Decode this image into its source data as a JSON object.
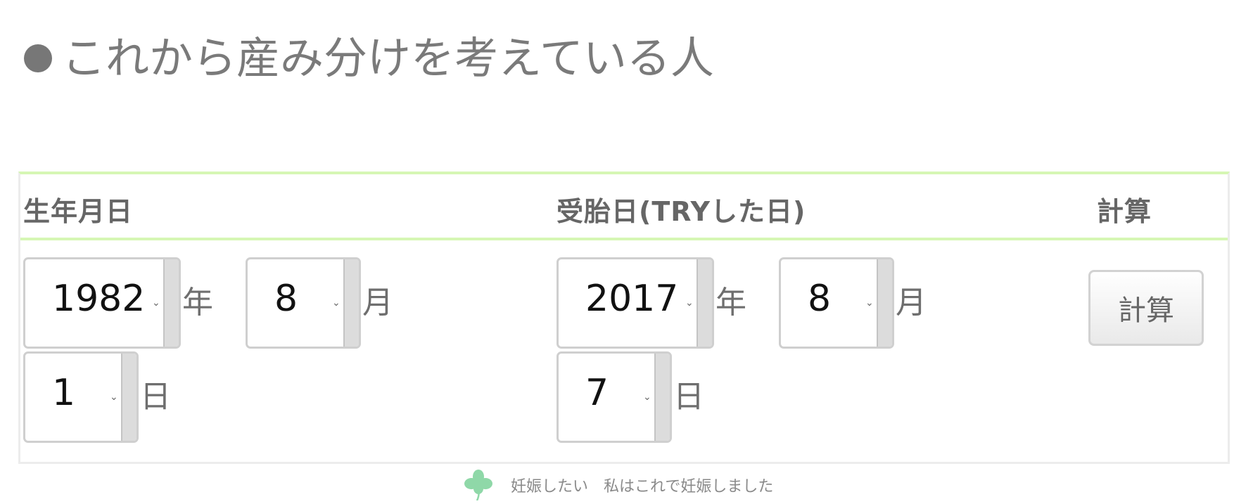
{
  "section": {
    "bullet_icon": "filled-circle-icon",
    "title": "これから産み分けを考えている人"
  },
  "table": {
    "headers": {
      "birthdate": "生年月日",
      "conception": "受胎日(TRYした日)",
      "calculate": "計算"
    },
    "birthdate": {
      "year": "1982",
      "year_unit": "年",
      "month": "8",
      "month_unit": "月",
      "day": "1",
      "day_unit": "日"
    },
    "conception": {
      "year": "2017",
      "year_unit": "年",
      "month": "8",
      "month_unit": "月",
      "day": "7",
      "day_unit": "日"
    },
    "calculate_button_label": "計算"
  },
  "footer": {
    "icon": "clover-icon",
    "text": "妊娠したい　私はこれで妊娠しました"
  },
  "colors": {
    "accent_border": "#d6f7b4",
    "clover": "#8fd8a8"
  }
}
